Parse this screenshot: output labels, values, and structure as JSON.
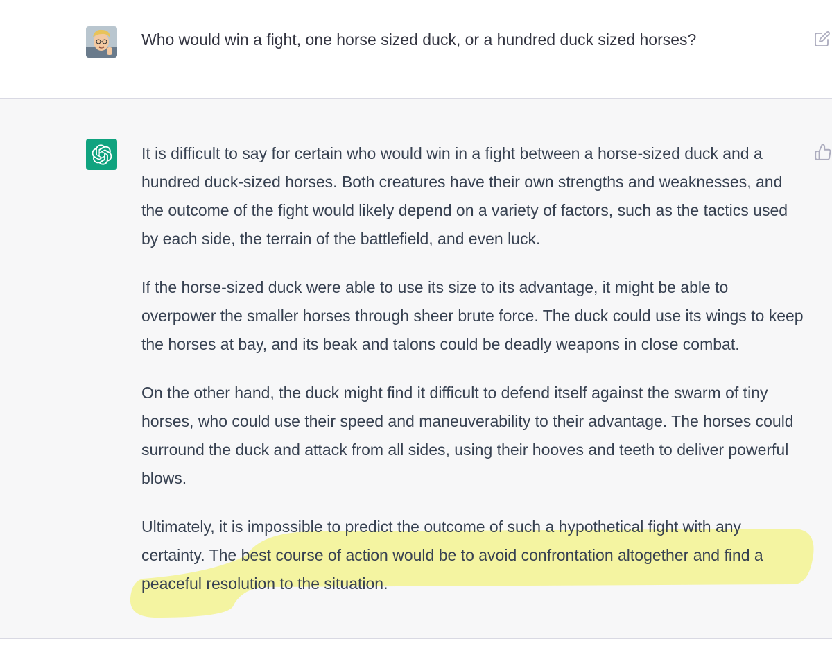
{
  "conversation": {
    "user_message": {
      "avatar": "user-avatar",
      "text": "Who would win a fight, one horse sized duck, or a hundred duck sized horses?",
      "icon": "edit-icon"
    },
    "assistant_message": {
      "avatar": "openai-logo-icon",
      "icon": "thumbs-up-icon",
      "paragraphs": [
        "It is difficult to say for certain who would win in a fight between a horse-sized duck and a hundred duck-sized horses. Both creatures have their own strengths and weaknesses, and the outcome of the fight would likely depend on a variety of factors, such as the tactics used by each side, the terrain of the battlefield, and even luck.",
        "If the horse-sized duck were able to use its size to its advantage, it might be able to overpower the smaller horses through sheer brute force. The duck could use its wings to keep the horses at bay, and its beak and talons could be deadly weapons in close combat.",
        "On the other hand, the duck might find it difficult to defend itself against the swarm of tiny horses, who could use their speed and maneuverability to their advantage. The horses could surround the duck and attack from all sides, using their hooves and teeth to deliver powerful blows.",
        "Ultimately, it is impossible to predict the outcome of such a hypothetical fight with any certainty. The best course of action would be to avoid confrontation altogether and find a peaceful resolution to the situation."
      ]
    },
    "colors": {
      "assistant_background": "#f7f7f8",
      "brand_green": "#10a37f",
      "highlight": "#f2f25a"
    }
  }
}
